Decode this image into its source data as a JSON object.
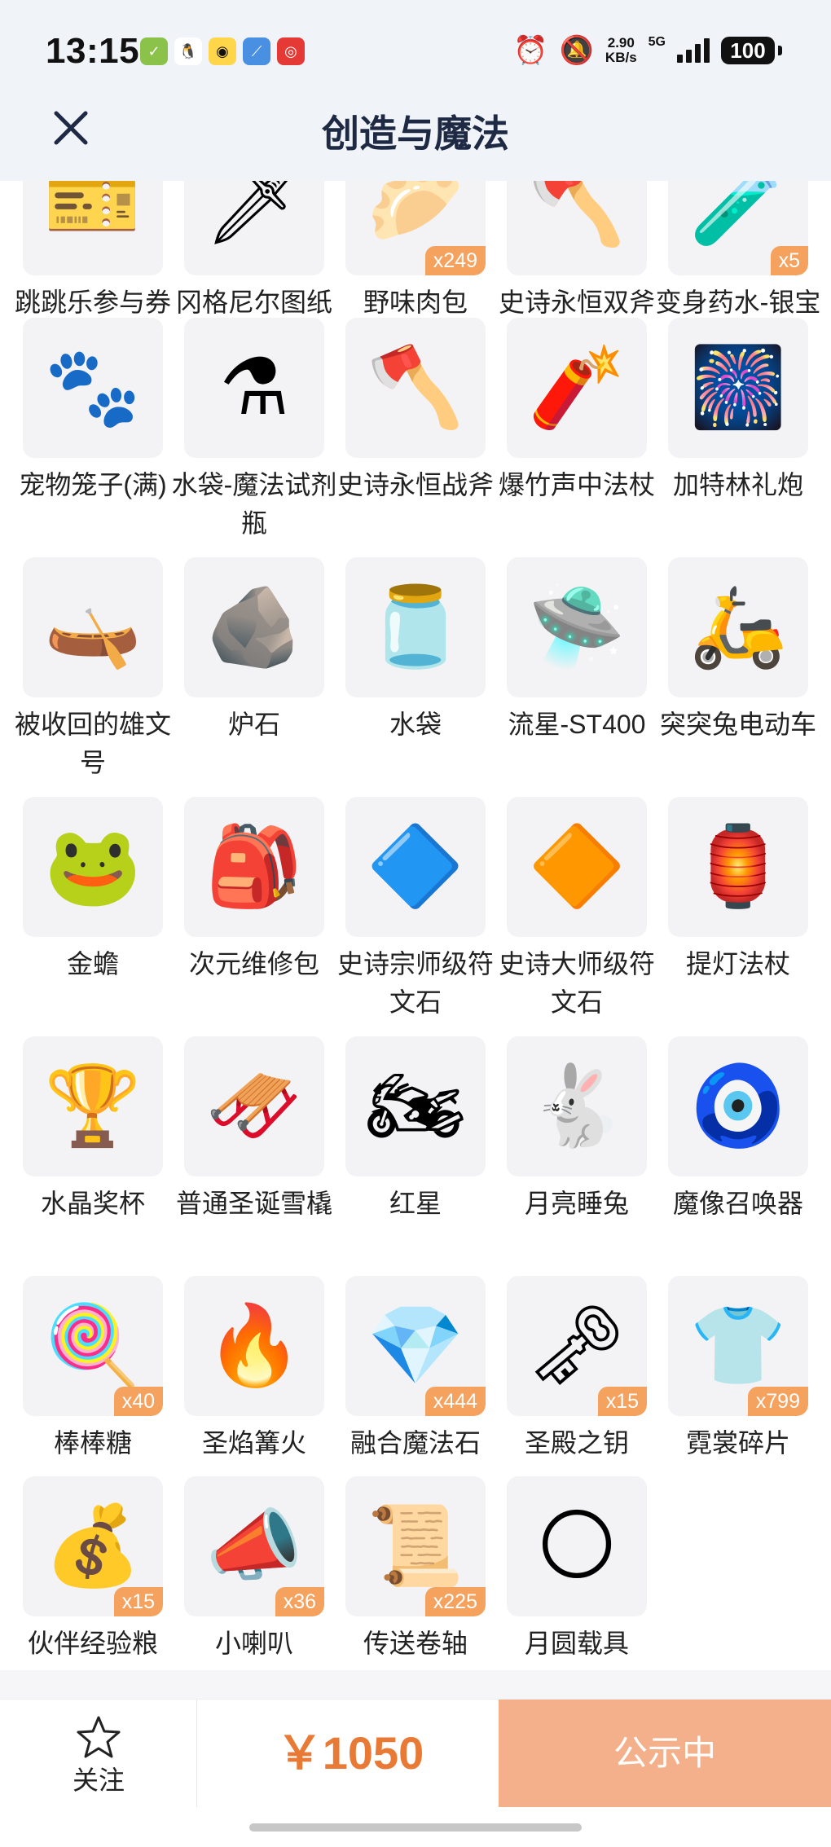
{
  "status_bar": {
    "time": "13:15",
    "net_speed_value": "2.90",
    "net_speed_unit": "KB/s",
    "network_type": "5G",
    "battery": "100"
  },
  "header": {
    "title": "创造与魔法"
  },
  "items": [
    {
      "name": "跳跳乐参与券",
      "icon": "ticket-icon",
      "glyph": "🎫",
      "badge": ""
    },
    {
      "name": "冈格尼尔图纸",
      "icon": "blueprint-icon",
      "glyph": "🗡",
      "badge": ""
    },
    {
      "name": "野味肉包",
      "icon": "bun-icon",
      "glyph": "🥟",
      "badge": "x249"
    },
    {
      "name": "史诗永恒双斧",
      "icon": "double-axe-icon",
      "glyph": "🪓",
      "badge": ""
    },
    {
      "name": "变身药水-银宝箱",
      "icon": "potion-icon",
      "glyph": "🧪",
      "badge": "x5"
    },
    {
      "name": "宠物笼子(满)",
      "icon": "pet-cage-icon",
      "glyph": "🐾",
      "badge": ""
    },
    {
      "name": "水袋-魔法试剂瓶",
      "icon": "magic-flask-icon",
      "glyph": "⚗",
      "badge": ""
    },
    {
      "name": "史诗永恒战斧",
      "icon": "battle-axe-icon",
      "glyph": "🪓",
      "badge": ""
    },
    {
      "name": "爆竹声中法杖",
      "icon": "firecracker-staff-icon",
      "glyph": "🧨",
      "badge": ""
    },
    {
      "name": "加特林礼炮",
      "icon": "cannon-icon",
      "glyph": "🎆",
      "badge": ""
    },
    {
      "name": "被收回的雄文号",
      "icon": "ship-wreck-icon",
      "glyph": "🛶",
      "badge": ""
    },
    {
      "name": "炉石",
      "icon": "hearthstone-icon",
      "glyph": "🪨",
      "badge": ""
    },
    {
      "name": "水袋",
      "icon": "water-bag-icon",
      "glyph": "🫙",
      "badge": ""
    },
    {
      "name": "流星-ST400",
      "icon": "hover-bike-icon",
      "glyph": "🛸",
      "badge": ""
    },
    {
      "name": "突突兔电动车",
      "icon": "scooter-icon",
      "glyph": "🛵",
      "badge": ""
    },
    {
      "name": "金蟾",
      "icon": "golden-toad-icon",
      "glyph": "🐸",
      "badge": ""
    },
    {
      "name": "次元维修包",
      "icon": "repair-bag-icon",
      "glyph": "🎒",
      "badge": ""
    },
    {
      "name": "史诗宗师级符文石",
      "icon": "rune-stone-icon",
      "glyph": "🔷",
      "badge": ""
    },
    {
      "name": "史诗大师级符文石",
      "icon": "rune-stone-gold-icon",
      "glyph": "🔶",
      "badge": ""
    },
    {
      "name": "提灯法杖",
      "icon": "lantern-staff-icon",
      "glyph": "🏮",
      "badge": ""
    },
    {
      "name": "水晶奖杯",
      "icon": "crystal-trophy-icon",
      "glyph": "🏆",
      "badge": ""
    },
    {
      "name": "普通圣诞雪橇",
      "icon": "sled-icon",
      "glyph": "🛷",
      "badge": ""
    },
    {
      "name": "红星",
      "icon": "motorcycle-icon",
      "glyph": "🏍",
      "badge": ""
    },
    {
      "name": "月亮睡兔",
      "icon": "moon-rabbit-icon",
      "glyph": "🐇",
      "badge": ""
    },
    {
      "name": "魔像召唤器",
      "icon": "golem-summoner-icon",
      "glyph": "🧿",
      "badge": ""
    },
    {
      "name": "棒棒糖",
      "icon": "lollipop-icon",
      "glyph": "🍭",
      "badge": "x40"
    },
    {
      "name": "圣焰篝火",
      "icon": "campfire-icon",
      "glyph": "🔥",
      "badge": ""
    },
    {
      "name": "融合魔法石",
      "icon": "magic-crystal-icon",
      "glyph": "💎",
      "badge": "x444"
    },
    {
      "name": "圣殿之钥",
      "icon": "key-icon",
      "glyph": "🗝",
      "badge": "x15"
    },
    {
      "name": "霓裳碎片",
      "icon": "shirt-fragment-icon",
      "glyph": "👕",
      "badge": "x799"
    },
    {
      "name": "伙伴经验粮",
      "icon": "food-bag-icon",
      "glyph": "💰",
      "badge": "x15"
    },
    {
      "name": "小喇叭",
      "icon": "megaphone-icon",
      "glyph": "📣",
      "badge": "x36"
    },
    {
      "name": "传送卷轴",
      "icon": "scroll-icon",
      "glyph": "📜",
      "badge": "x225"
    },
    {
      "name": "月圆载具",
      "icon": "moon-orb-icon",
      "glyph": "🌕",
      "badge": ""
    }
  ],
  "bottom_bar": {
    "follow_label": "关注",
    "price": "￥1050",
    "status_button": "公示中"
  },
  "colors": {
    "accent_orange": "#e87a36",
    "button_orange": "#f3b08a",
    "badge_orange": "#f4a25e",
    "title_navy": "#1e2a44"
  }
}
